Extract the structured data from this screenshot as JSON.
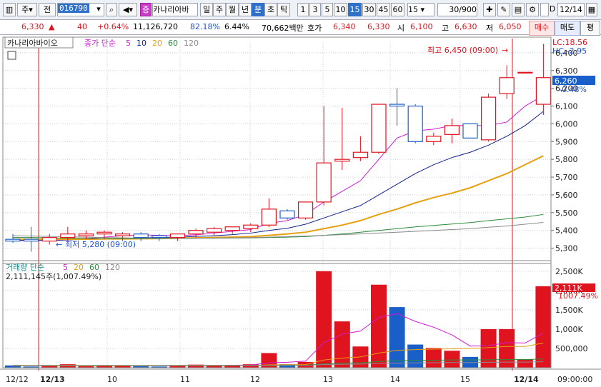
{
  "toolbar": {
    "market": "주",
    "scope": "전",
    "code": "016790",
    "badge": "증",
    "name": "카나리아바",
    "periods": [
      "일",
      "주",
      "월",
      "년",
      "분",
      "초",
      "틱"
    ],
    "active_period": "분",
    "minutes": [
      "1",
      "3",
      "5",
      "10",
      "15",
      "30",
      "45",
      "60"
    ],
    "active_minute": "15",
    "interval_value": "15",
    "count": "30",
    "count_max": "/900",
    "date": "12/14",
    "d_label": "D"
  },
  "quote": {
    "price": "6,330",
    "arrow": "▲",
    "change": "40",
    "change_pct": "+0.64%",
    "volume": "11,126,720",
    "vol_ratio": "82.18%",
    "turnover": "6.44%",
    "amount": "70,662백만",
    "ask_label": "호가",
    "ask1": "6,340",
    "ask2": "6,330",
    "open_label": "시",
    "open": "6,100",
    "high_label": "고",
    "high": "6,630",
    "low_label": "저",
    "low": "6,050",
    "buy_label": "매수",
    "sell_label": "매도",
    "eval_label": "평"
  },
  "price_panel": {
    "name_box": "카나리아바이오",
    "ma_title": "종가 단순",
    "ma_periods": [
      "5",
      "10",
      "20",
      "60",
      "120"
    ],
    "max_label": "최고 6,450 (09:00)",
    "min_label": "최저 5,280 (09:00)",
    "lc": "LC:18.56",
    "hc": "HC:-2.95",
    "current_price": "6,260",
    "current_pct": "-0.48%"
  },
  "volume_panel": {
    "title": "거래량 단순",
    "ma_periods": [
      "5",
      "20",
      "60",
      "120"
    ],
    "info": "2,111,145주(1,007.49%)",
    "current": "2,111K",
    "current_pct": "1007.49%"
  },
  "time_axis": {
    "left_start": "12/12",
    "left_date": "12/13",
    "right_date": "12/14",
    "labels": [
      "10",
      "11",
      "12",
      "13",
      "14",
      "15"
    ],
    "corner": "09:00:00"
  },
  "colors": {
    "up": "#e0141e",
    "down": "#1a5fc9",
    "ma5": "#d21ad2",
    "ma10": "#10208a",
    "ma20": "#e6a010",
    "ma60": "#2a8a3a",
    "ma120": "#8a8a8a",
    "grid": "#c8d0dc"
  },
  "chart_data": {
    "type": "candlestick",
    "y_ticks": [
      5300,
      5400,
      5500,
      5600,
      5700,
      5800,
      5900,
      6000,
      6100,
      6200,
      6300,
      6400
    ],
    "ylim": [
      5230,
      6480
    ],
    "volume_ticks": [
      500000,
      1000000,
      1500000,
      2000000,
      2500000
    ],
    "volume_tick_labels": [
      "500,000",
      "1,000K",
      "1,500K",
      "2,000K",
      "2,500K"
    ],
    "volume_ylim": [
      0,
      2700000
    ],
    "candles": [
      {
        "o": 5350,
        "h": 5380,
        "l": 5330,
        "c": 5340,
        "v": 60000
      },
      {
        "o": 5350,
        "h": 5420,
        "l": 5280,
        "c": 5340,
        "v": 30000
      },
      {
        "o": 5340,
        "h": 5380,
        "l": 5320,
        "c": 5360,
        "v": 60000
      },
      {
        "o": 5360,
        "h": 5420,
        "l": 5340,
        "c": 5380,
        "v": 90000
      },
      {
        "o": 5370,
        "h": 5400,
        "l": 5350,
        "c": 5380,
        "v": 40000
      },
      {
        "o": 5380,
        "h": 5400,
        "l": 5350,
        "c": 5390,
        "v": 50000
      },
      {
        "o": 5370,
        "h": 5390,
        "l": 5340,
        "c": 5380,
        "v": 60000
      },
      {
        "o": 5380,
        "h": 5390,
        "l": 5340,
        "c": 5360,
        "v": 40000
      },
      {
        "o": 5370,
        "h": 5380,
        "l": 5340,
        "c": 5360,
        "v": 30000
      },
      {
        "o": 5360,
        "h": 5380,
        "l": 5340,
        "c": 5380,
        "v": 50000
      },
      {
        "o": 5380,
        "h": 5410,
        "l": 5360,
        "c": 5400,
        "v": 80000
      },
      {
        "o": 5390,
        "h": 5420,
        "l": 5370,
        "c": 5410,
        "v": 60000
      },
      {
        "o": 5400,
        "h": 5420,
        "l": 5380,
        "c": 5420,
        "v": 70000
      },
      {
        "o": 5410,
        "h": 5440,
        "l": 5390,
        "c": 5430,
        "v": 90000
      },
      {
        "o": 5430,
        "h": 5580,
        "l": 5420,
        "c": 5520,
        "v": 380000
      },
      {
        "o": 5510,
        "h": 5520,
        "l": 5460,
        "c": 5470,
        "v": 90000
      },
      {
        "o": 5470,
        "h": 5560,
        "l": 5460,
        "c": 5560,
        "v": 150000
      },
      {
        "o": 5560,
        "h": 6100,
        "l": 5540,
        "c": 5780,
        "v": 2500000
      },
      {
        "o": 5790,
        "h": 6090,
        "l": 5740,
        "c": 5800,
        "v": 1200000
      },
      {
        "o": 5810,
        "h": 5930,
        "l": 5790,
        "c": 5840,
        "v": 550000
      },
      {
        "o": 5840,
        "h": 6110,
        "l": 5830,
        "c": 6110,
        "v": 2150000
      },
      {
        "o": 6110,
        "h": 6200,
        "l": 5990,
        "c": 6100,
        "v": 1570000
      },
      {
        "o": 6100,
        "h": 6110,
        "l": 5890,
        "c": 5900,
        "v": 600000
      },
      {
        "o": 5900,
        "h": 5950,
        "l": 5880,
        "c": 5930,
        "v": 510000
      },
      {
        "o": 5940,
        "h": 6030,
        "l": 5890,
        "c": 5990,
        "v": 440000
      },
      {
        "o": 6000,
        "h": 6000,
        "l": 5920,
        "c": 5920,
        "v": 280000
      },
      {
        "o": 5910,
        "h": 6170,
        "l": 5900,
        "c": 6150,
        "v": 1000000
      },
      {
        "o": 6170,
        "h": 6330,
        "l": 6140,
        "c": 6260,
        "v": 1000000
      },
      {
        "o": 6290,
        "h": 6290,
        "l": 6290,
        "c": 6290,
        "v": 220000
      },
      {
        "o": 6110,
        "h": 6450,
        "l": 6050,
        "c": 6260,
        "v": 2111145
      }
    ],
    "ma_series": [
      {
        "name": "5",
        "values": [
          5340,
          5345,
          5342,
          5350,
          5355,
          5362,
          5370,
          5375,
          5372,
          5370,
          5375,
          5385,
          5395,
          5405,
          5440,
          5455,
          5490,
          5560,
          5620,
          5680,
          5800,
          5920,
          5960,
          5970,
          5990,
          5990,
          5990,
          6010,
          6100,
          6160
        ]
      },
      {
        "name": "10",
        "values": [
          5345,
          5345,
          5343,
          5346,
          5350,
          5352,
          5355,
          5358,
          5360,
          5362,
          5366,
          5370,
          5376,
          5385,
          5400,
          5412,
          5435,
          5470,
          5505,
          5540,
          5600,
          5660,
          5720,
          5770,
          5810,
          5840,
          5880,
          5930,
          5990,
          6070
        ]
      },
      {
        "name": "20",
        "values": [
          5350,
          5350,
          5350,
          5350,
          5350,
          5352,
          5352,
          5353,
          5354,
          5356,
          5358,
          5360,
          5362,
          5365,
          5372,
          5380,
          5390,
          5410,
          5430,
          5455,
          5490,
          5520,
          5555,
          5585,
          5610,
          5640,
          5680,
          5720,
          5770,
          5820
        ]
      },
      {
        "name": "60",
        "values": [
          5360,
          5360,
          5358,
          5356,
          5355,
          5354,
          5354,
          5354,
          5354,
          5355,
          5356,
          5356,
          5357,
          5358,
          5360,
          5362,
          5365,
          5372,
          5380,
          5390,
          5400,
          5410,
          5420,
          5428,
          5436,
          5444,
          5455,
          5465,
          5475,
          5490
        ]
      },
      {
        "name": "120",
        "values": [
          5370,
          5368,
          5366,
          5364,
          5362,
          5360,
          5358,
          5357,
          5356,
          5356,
          5356,
          5357,
          5358,
          5360,
          5362,
          5365,
          5368,
          5372,
          5376,
          5380,
          5385,
          5390,
          5395,
          5400,
          5405,
          5410,
          5418,
          5425,
          5435,
          5445
        ]
      }
    ],
    "volume_ma": [
      {
        "name": "5",
        "values": [
          60000,
          55000,
          50000,
          55000,
          55000,
          55000,
          55000,
          55000,
          55000,
          50000,
          55000,
          60000,
          65000,
          70000,
          130000,
          140000,
          170000,
          650000,
          870000,
          950000,
          1300000,
          1400000,
          1200000,
          1050000,
          850000,
          560000,
          570000,
          650000,
          640000,
          900000
        ]
      },
      {
        "name": "20",
        "values": [
          50000,
          50000,
          50000,
          52000,
          52000,
          52000,
          52000,
          52000,
          52000,
          52000,
          53000,
          54000,
          55000,
          57000,
          75000,
          78000,
          82000,
          200000,
          250000,
          280000,
          380000,
          450000,
          470000,
          480000,
          490000,
          500000,
          520000,
          550000,
          550000,
          640000
        ]
      },
      {
        "name": "60",
        "values": [
          60000,
          60000,
          60000,
          60000,
          60000,
          60000,
          60000,
          60000,
          60000,
          60000,
          60000,
          60000,
          60000,
          60000,
          60000,
          60000,
          65000,
          100000,
          120000,
          130000,
          160000,
          180000,
          190000,
          195000,
          200000,
          200000,
          205000,
          210000,
          210000,
          230000
        ]
      },
      {
        "name": "120",
        "values": [
          60000,
          60000,
          60000,
          60000,
          60000,
          60000,
          60000,
          60000,
          60000,
          60000,
          60000,
          60000,
          60000,
          60000,
          60000,
          60000,
          62000,
          80000,
          90000,
          95000,
          110000,
          120000,
          125000,
          130000,
          135000,
          135000,
          140000,
          145000,
          145000,
          155000
        ]
      }
    ]
  }
}
